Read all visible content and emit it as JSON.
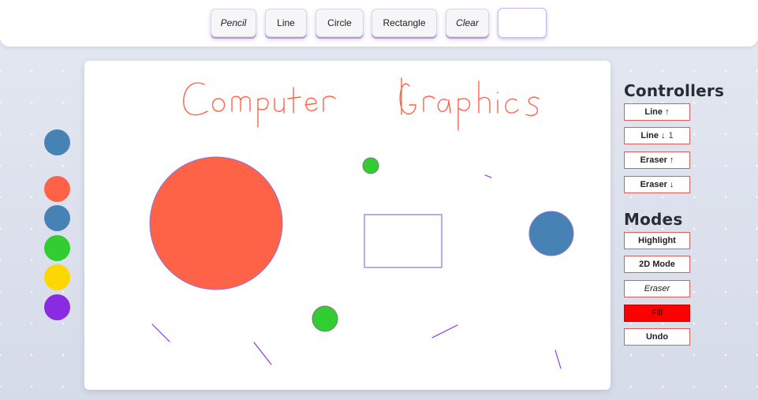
{
  "toolbar": {
    "pencil": "Pencil",
    "line": "Line",
    "circle": "Circle",
    "rectangle": "Rectangle",
    "clear": "Clear"
  },
  "palette": {
    "selected_color": "#4682b4",
    "colors": [
      "#ff6347",
      "#4682b4",
      "#32cd32",
      "#ffd700",
      "#8a2be2"
    ]
  },
  "canvas": {
    "handwritten_text": "Computer Graphics",
    "stroke_colors": {
      "pen": "#ff6347",
      "shape_outline": "#9370db",
      "line": "#8a2be2"
    }
  },
  "controllers": {
    "title": "Controllers",
    "line_up": "Line ↑",
    "line_down": "Line ↓",
    "line_down_value": "1",
    "eraser_up": "Eraser ↑",
    "eraser_down": "Eraser ↓"
  },
  "modes": {
    "title": "Modes",
    "highlight": "Highlight",
    "mode_2d": "2D Mode",
    "eraser": "Eraser",
    "fill": "Fill",
    "undo": "Undo"
  }
}
